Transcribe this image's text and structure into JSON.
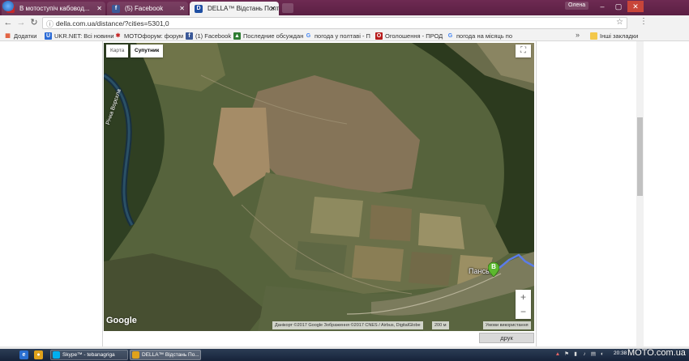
{
  "browser": {
    "tabs": [
      {
        "label": "В мотоступіч кабовод...",
        "active": false,
        "icon": "moto-forum-icon"
      },
      {
        "label": "(5) Facebook",
        "active": false,
        "icon": "facebook-icon"
      },
      {
        "label": "DELLA™ Відстань Полта...",
        "active": true,
        "icon": "della-icon"
      }
    ],
    "user_label": "Олена",
    "window_controls": {
      "minimize": "‒",
      "maximize": "▢",
      "close": "✕"
    },
    "nav": {
      "back": "←",
      "forward": "→",
      "reload": "↻"
    },
    "address": "della.com.ua/distance/?cities=5301,0",
    "bookmarks": [
      {
        "label": "Додатки",
        "icon": "apps-icon",
        "color": "#e0532f"
      },
      {
        "label": "UKR.NET: Всі новини",
        "icon": "ukrnet-icon",
        "color": "#2b6bd6"
      },
      {
        "label": "MOTOфорум: форум",
        "icon": "moto-forum-icon",
        "color": "#c62828"
      },
      {
        "label": "(1) Facebook",
        "icon": "facebook-icon",
        "color": "#3b5998"
      },
      {
        "label": "Последние обсуждан",
        "icon": "forum-icon",
        "color": "#2e7d32"
      },
      {
        "label": "погода у полтаві - П",
        "icon": "google-icon",
        "color": "#4285f4"
      },
      {
        "label": "Оголошення - ПРОД",
        "icon": "ads-icon",
        "color": "#b71c1c"
      },
      {
        "label": "погода на місяць по",
        "icon": "google-icon",
        "color": "#4285f4"
      }
    ],
    "bookmarks_overflow": "»",
    "other_bookmarks": "Інші закладки"
  },
  "map": {
    "map_types": [
      "Карта",
      "Супутник"
    ],
    "active_type": "Супутник",
    "zoom_in": "+",
    "zoom_out": "−",
    "fullscreen_icon": "⛶",
    "logo": "Google",
    "attribution": "Данікорт ©2017 Google Зображення ©2017 CNES / Airbus, DigitalGlobe",
    "scale": "200 м",
    "terms": "Умови використання",
    "river_label": "Річка Ворскла",
    "place_label": "Панськ.",
    "marker_letter": "B",
    "marker_color": "#5cb82e",
    "route_color": "#5b7ce8"
  },
  "page": {
    "print_button": "друк"
  },
  "taskbar": {
    "tasks": [
      {
        "label": "Skype™ - tebanagriga",
        "icon": "skype-icon",
        "color": "#00aff0"
      },
      {
        "label": "DELLA™ Відстань По...",
        "icon": "chrome-icon",
        "color": "#e0a21b"
      }
    ],
    "clock": "20:38",
    "watermark": "MOTO.com.ua"
  }
}
